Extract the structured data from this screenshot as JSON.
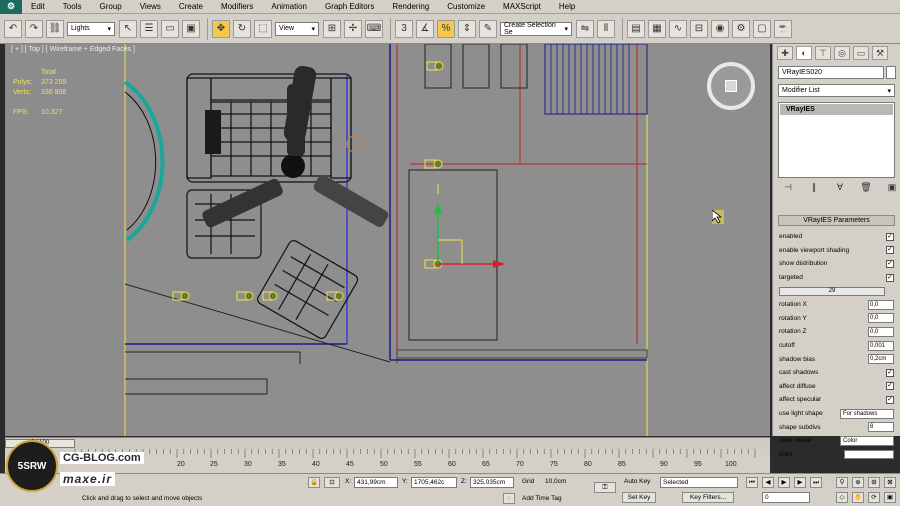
{
  "menu": {
    "logo": "⚙",
    "items": [
      "Edit",
      "Tools",
      "Group",
      "Views",
      "Create",
      "Modifiers",
      "Animation",
      "Graph Editors",
      "Rendering",
      "Customize",
      "MAXScript",
      "Help"
    ]
  },
  "toolbar": {
    "selection_filter": "Lights",
    "ref_coord": "View",
    "named_selection_placeholder": "Create Selection Se",
    "snap_value": "3"
  },
  "viewport": {
    "label": "[ + ] [ Top ] [ Wireframe + Edged Faces ]",
    "stats": {
      "title": "Total",
      "polys_label": "Polys:",
      "polys": "373 259",
      "verts_label": "Verts:",
      "verts": "336 806",
      "fps_label": "FPS:",
      "fps": "10.327"
    },
    "colors": {
      "background": "#8e8e8e",
      "wire": "#1a1a1a",
      "selection": "#f2e34a",
      "gizmo_red": "#d42020",
      "gizmo_green": "#20c040"
    }
  },
  "command_panel": {
    "object_name": "VRayIES020",
    "modifier_list": "Modifier List",
    "stack_item": "VRayIES",
    "rollout_title": "VRayIES Parameters",
    "params": [
      {
        "label": "enabled",
        "type": "check",
        "value": "✓"
      },
      {
        "label": "enable viewport shading",
        "type": "check",
        "value": "✓"
      },
      {
        "label": "show distribution",
        "type": "check",
        "value": "✓"
      },
      {
        "label": "targeted",
        "type": "check",
        "value": "✓"
      },
      {
        "label": "29",
        "type": "slider"
      },
      {
        "label": "rotation X",
        "type": "spin",
        "value": "0,0"
      },
      {
        "label": "rotation Y",
        "type": "spin",
        "value": "0,0"
      },
      {
        "label": "rotation Z",
        "type": "spin",
        "value": "0,0"
      },
      {
        "label": "cutoff",
        "type": "spin",
        "value": "0,001"
      },
      {
        "label": "shadow bias",
        "type": "spin",
        "value": "0,2cm"
      },
      {
        "label": "cast shadows",
        "type": "check",
        "value": "✓"
      },
      {
        "label": "affect diffuse",
        "type": "check",
        "value": "✓"
      },
      {
        "label": "affect specular",
        "type": "check",
        "value": "✓"
      },
      {
        "label": "use light shape",
        "type": "drop",
        "value": "For shadows"
      },
      {
        "label": "shape subdivs",
        "type": "spin",
        "value": "8"
      },
      {
        "label": "color mode",
        "type": "drop",
        "value": "Color"
      },
      {
        "label": "color",
        "type": "swatch"
      }
    ]
  },
  "timeline": {
    "thumb": "0 / 100",
    "ticks": [
      "20",
      "25",
      "30",
      "35",
      "40",
      "45",
      "50",
      "55",
      "60",
      "65",
      "70",
      "75",
      "80",
      "85",
      "90",
      "95",
      "100"
    ]
  },
  "status": {
    "prompt": "Click and drag to select and move objects",
    "x_label": "X:",
    "x": "431,99cm",
    "y_label": "Y:",
    "y": "1705,462c",
    "z_label": "Z:",
    "z": "325,035cm",
    "grid_label": "Grid",
    "grid": "10,0cm",
    "add_time_tag": "Add Time Tag",
    "auto_key": "Auto Key",
    "auto_key_mode": "Selected",
    "set_key": "Set Key",
    "key_filters": "Key Filters...",
    "frame": "0"
  },
  "watermark": {
    "badge": "5SRW",
    "blog": "CG-BLOG.com",
    "site": "maxe.ir"
  }
}
